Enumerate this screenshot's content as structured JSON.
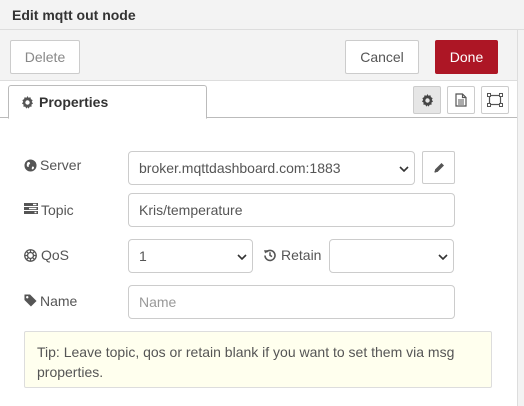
{
  "window": {
    "title": "Edit mqtt out node"
  },
  "toolbar": {
    "delete_label": "Delete",
    "cancel_label": "Cancel",
    "done_label": "Done"
  },
  "tabs": [
    {
      "label": "Properties",
      "icon": "gear-icon",
      "active": true
    }
  ],
  "tab_buttons": [
    {
      "icon": "gear-icon",
      "active": true
    },
    {
      "icon": "document-icon",
      "active": false
    },
    {
      "icon": "appearance-icon",
      "active": false
    }
  ],
  "form": {
    "server": {
      "label": "Server",
      "icon": "globe-icon",
      "value": "broker.mqttdashboard.com:1883",
      "edit_icon": "pencil-icon"
    },
    "topic": {
      "label": "Topic",
      "icon": "tasks-icon",
      "value": "Kris/temperature"
    },
    "qos": {
      "label": "QoS",
      "icon": "empire-icon",
      "value": "1"
    },
    "retain": {
      "label": "Retain",
      "icon": "history-icon",
      "value": ""
    },
    "name": {
      "label": "Name",
      "icon": "tag-icon",
      "value": "",
      "placeholder": "Name"
    }
  },
  "tip": {
    "text": "Tip: Leave topic, qos or retain blank if you want to set them via msg properties."
  },
  "colors": {
    "accent": "#ad1625",
    "header_bg": "#f3f3f3",
    "tip_bg": "#ffffee"
  }
}
